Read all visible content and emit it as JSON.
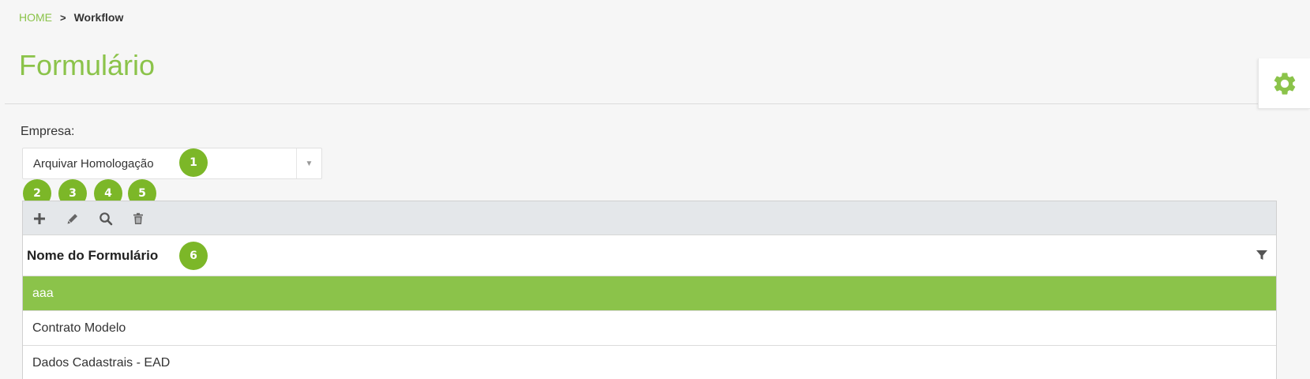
{
  "breadcrumb": {
    "home": "HOME",
    "separator": ">",
    "current": "Workflow"
  },
  "page": {
    "title": "Formulário"
  },
  "settings": {
    "icon": "gear-icon",
    "accent": "#8bc34a"
  },
  "filter": {
    "label": "Empresa:",
    "selected": "Arquivar Homologação",
    "arrow": "▼"
  },
  "badges": [
    "1",
    "2",
    "3",
    "4",
    "5",
    "6"
  ],
  "toolbar": {
    "buttons": [
      {
        "name": "add",
        "icon": "plus-icon"
      },
      {
        "name": "edit",
        "icon": "pencil-icon"
      },
      {
        "name": "search",
        "icon": "search-icon"
      },
      {
        "name": "delete",
        "icon": "trash-icon"
      }
    ]
  },
  "grid": {
    "column_header": "Nome do Formulário",
    "rows": [
      "aaa",
      "Contrato Modelo",
      "Dados Cadastrais - EAD"
    ],
    "selected_index": 0
  },
  "colors": {
    "accent": "#8bc34a",
    "badge": "#7cb728",
    "toolbar_bg": "#e4e7ea"
  }
}
